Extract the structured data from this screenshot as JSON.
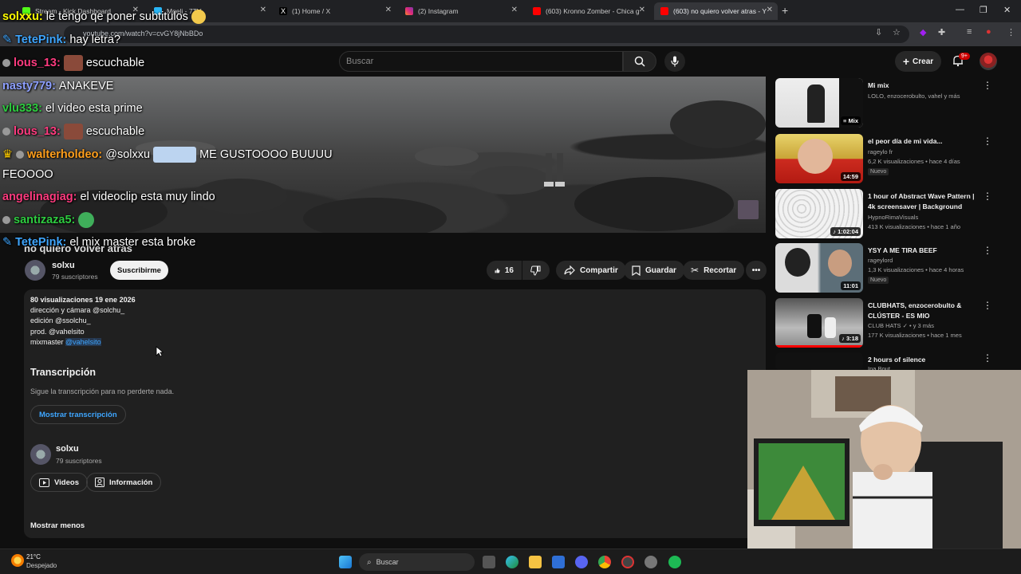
{
  "browser": {
    "tabs": [
      {
        "label": "Stream - Kick Dashboard",
        "color": "#53fc18"
      },
      {
        "label": "Mgeli - 7TV",
        "color": "#29b6f6"
      },
      {
        "label": "(1) Home / X",
        "color": "#ffffff"
      },
      {
        "label": "(2) Instagram",
        "color": "#e1306c"
      },
      {
        "label": "(603) Kronno Zomber - Chica g",
        "color": "#ff0000"
      },
      {
        "label": "(603) no quiero volver atras - Y",
        "color": "#ff0000"
      }
    ],
    "url": "youtube.com/watch?v=cvGY8jNbBDo"
  },
  "header": {
    "search_placeholder": "Buscar",
    "create_label": "Crear",
    "notif_count": "9+"
  },
  "chat": [
    {
      "user": "solxxu:",
      "msg": "le tengo qe poner subtitulos",
      "color": "#ffff00"
    },
    {
      "user": "TetePink:",
      "msg": "hay letra?",
      "color": "#3ea6ff"
    },
    {
      "user": "lous_13:",
      "msg": "escuchable",
      "color": "#ff3b7f"
    },
    {
      "user": "nasty779:",
      "msg": "ANAKEVE",
      "color": "#8ea0ff"
    },
    {
      "user": "vlu333:",
      "msg": "el video esta prime",
      "color": "#2ecc40"
    },
    {
      "user": "lous_13:",
      "msg": "escuchable",
      "color": "#ff3b7f"
    },
    {
      "user": "walterholdeo:",
      "msg": "@solxxu",
      "msg2": "ME GUSTOOOO BUUUU",
      "color": "#ff9f1c"
    },
    {
      "user": "",
      "msg": "FEOOOO",
      "color": "#ffffff"
    },
    {
      "user": "angelinagiag:",
      "msg": "el videoclip esta muy lindo",
      "color": "#ff3b7f"
    },
    {
      "user": "santizaza5:",
      "msg": "",
      "color": "#2ecc40"
    },
    {
      "user": "TetePink:",
      "msg": "el mix master esta broke",
      "color": "#3ea6ff"
    }
  ],
  "video": {
    "title": "no quiero volver atras",
    "channel": "solxu",
    "subscribers": "79 suscriptores",
    "subscribe_label": "Suscribirme",
    "likes": "16",
    "share_label": "Compartir",
    "save_label": "Guardar",
    "clip_label": "Recortar"
  },
  "description": {
    "stats": "80 visualizaciones  19 ene 2026",
    "lines": [
      "dirección y cámara @solchu_",
      "edición @ssolchu_",
      "prod. @vahelsito"
    ],
    "mix_prefix": "mixmaster",
    "mix_tag": "@vahelsito",
    "transcript_title": "Transcripción",
    "transcript_sub": "Sigue la transcripción para no perderte nada.",
    "transcript_button": "Mostrar transcripción",
    "channel_name": "solxu",
    "channel_subs": "79 suscriptores",
    "videos_label": "Videos",
    "info_label": "Información",
    "show_less": "Mostrar menos"
  },
  "sidebar": [
    {
      "title": "Mi mix",
      "meta1": "LOLO, enzocerobulto, vahel y más",
      "meta2": "",
      "badge": "",
      "duration": "Mix",
      "thumb": "#2a2a2a"
    },
    {
      "title": "el peor día de mi vida...",
      "meta1": "rageylo fr",
      "meta2": "6,2 K visualizaciones • hace 4 días",
      "badge": "Nuevo",
      "duration": "14:59",
      "thumb": "#c8b040"
    },
    {
      "title": "1 hour of Abstract Wave Pattern | 4k screensaver | Background",
      "meta1": "HypnoRimaVisuals",
      "meta2": "413 K visualizaciones • hace 1 año",
      "badge": "",
      "duration": "1:02:04",
      "thumb": "#d8d8d8"
    },
    {
      "title": "YSY A ME TIRA BEEF",
      "meta1": "rageylord",
      "meta2": "1,3 K visualizaciones • hace 4 horas",
      "badge": "Nuevo",
      "duration": "11:01",
      "thumb": "#6a7a8a"
    },
    {
      "title": "CLUBHATS, enzocerobulto & CLÚSTER - ES MIO",
      "meta1": "CLUB HATS ✓ • y 3 más",
      "meta2": "177 K visualizaciones • hace 1 mes",
      "badge": "",
      "duration": "3:18",
      "thumb": "#888888"
    },
    {
      "title": "2 hours of silence",
      "meta1": "Ina Bout",
      "meta2": "",
      "badge": "",
      "duration": "",
      "thumb": "#111111"
    }
  ],
  "taskbar": {
    "temperature": "21°C",
    "weather": "Despejado",
    "search_placeholder": "Buscar"
  }
}
